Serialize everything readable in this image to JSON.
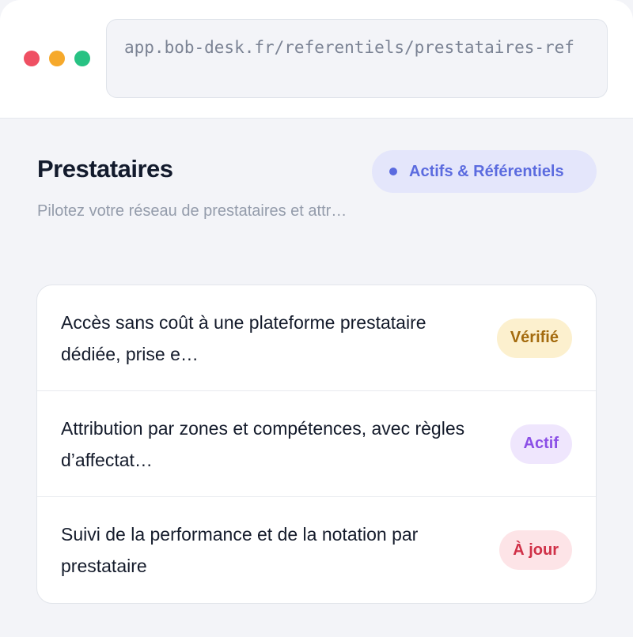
{
  "browser": {
    "url": "app.bob-desk.fr/referentiels/prestataires-ref"
  },
  "header": {
    "title": "Prestataires",
    "subtitle": "Pilotez votre réseau de prestataires et attr…",
    "section_badge": "Actifs & Référentiels"
  },
  "items": [
    {
      "text": "Accès sans coût à une plateforme prestataire dédiée, prise e…",
      "status": "Vérifié",
      "status_color": "#a46b0e"
    },
    {
      "text": "Attribution par zones et compétences, avec règles d’affectat…",
      "status": "Actif",
      "status_color": "#8b4fe6"
    },
    {
      "text": "Suivi de la performance et de la notation par prestataire",
      "status": "À jour",
      "status_color": "#d03047"
    }
  ],
  "colors": {
    "accent": "#5b6bdf",
    "window_red": "#ef5063",
    "window_yellow": "#f6a92b",
    "window_green": "#27c283"
  }
}
